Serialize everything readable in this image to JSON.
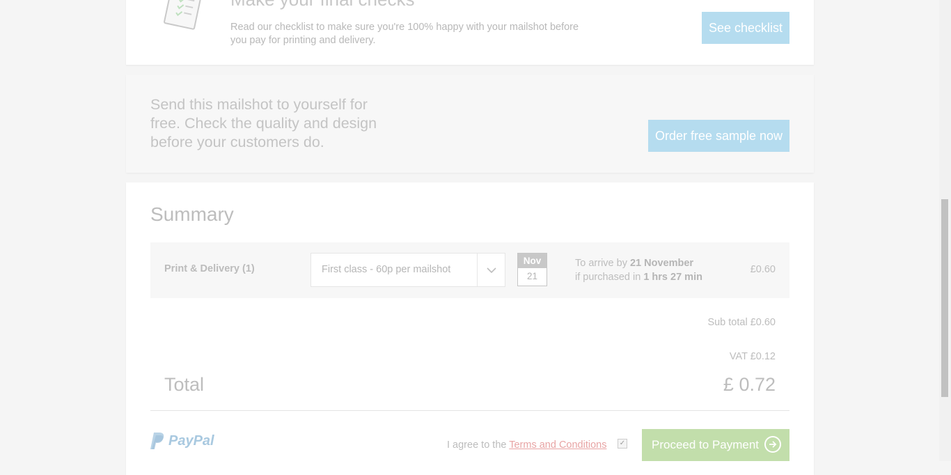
{
  "checks": {
    "title": "Make your final checks",
    "text": "Read our checklist to make sure you're 100% happy with your mailshot before you pay for printing and delivery.",
    "button": "See checklist",
    "icon": "checklist-icon"
  },
  "sample": {
    "text": "Send this mailshot to yourself for free. Check the quality and design before your customers do.",
    "button": "Order free sample now"
  },
  "summary": {
    "title": "Summary",
    "row_label": "Print & Delivery (1)",
    "delivery_option": "First class - 60p per mailshot",
    "date_month": "Nov",
    "date_day": "21",
    "arrive_prefix": "To arrive by ",
    "arrive_date": "21 November",
    "purchase_prefix": "if purchased in ",
    "purchase_time": "1 hrs 27 min",
    "row_price": "£0.60",
    "subtotal": "Sub total £0.60",
    "vat": "VAT £0.12",
    "total_label": "Total",
    "total_value": "£ 0.72"
  },
  "payment": {
    "paypal_text": "PayPal",
    "agree_prefix": "I agree to the ",
    "terms_link": "Terms and Conditions",
    "agree_checked": true,
    "proceed_button": "Proceed to Payment"
  },
  "colors": {
    "button_blue": "#b5dcef",
    "proceed_green": "#c2deab",
    "terms_link": "#e8a4a4"
  }
}
